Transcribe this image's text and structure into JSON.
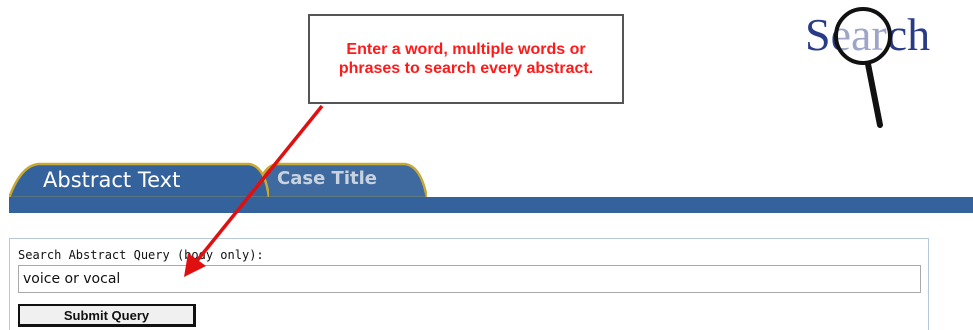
{
  "callout": {
    "text": "Enter a word, multiple words or phrases to search every abstract."
  },
  "logo": {
    "text": "Search",
    "icon": "magnifying-glass-icon"
  },
  "tabs": [
    {
      "label": "Abstract Text",
      "active": true
    },
    {
      "label": "Case Title",
      "active": false
    }
  ],
  "form": {
    "label": "Search Abstract Query (body only):",
    "query_value": "voice or vocal",
    "submit_label": "Submit Query"
  },
  "colors": {
    "callout_text": "#ff1a1a",
    "tab_bar": "#34629c",
    "tab_active": "#34629c",
    "tab_inactive_fill": "#3e6a9f",
    "tab_inactive_border": "#c8a933",
    "logo": "#283b86",
    "arrow": "#e01010"
  }
}
